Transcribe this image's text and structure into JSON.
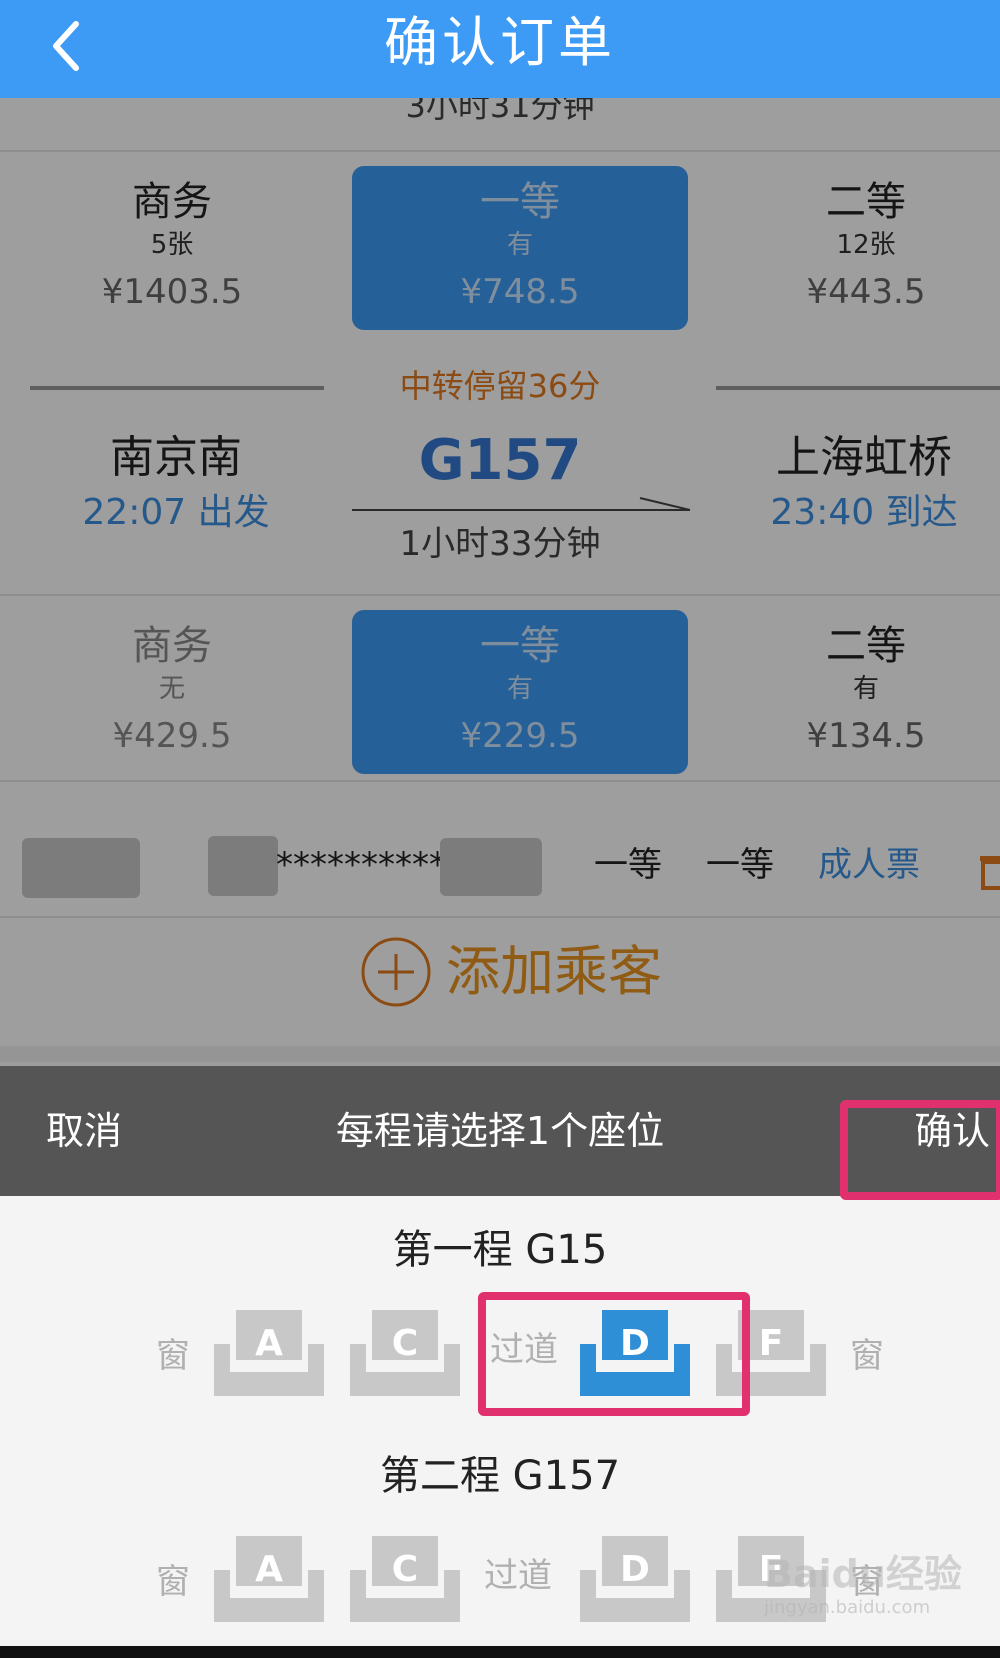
{
  "header": {
    "title": "确认订单"
  },
  "previous_leg": {
    "duration": "3小时31分钟"
  },
  "leg1_seats": [
    {
      "class": "商务",
      "count": "5张",
      "price": "¥1403.5",
      "selected": false
    },
    {
      "class": "一等",
      "count": "有",
      "price": "¥748.5",
      "selected": true
    },
    {
      "class": "二等",
      "count": "12张",
      "price": "¥443.5",
      "selected": false
    }
  ],
  "transfer": {
    "text": "中转停留36分"
  },
  "leg2": {
    "from_station": "南京南",
    "depart_time": "22:07 出发",
    "train_no": "G157",
    "duration": "1小时33分钟",
    "to_station": "上海虹桥",
    "arrive_time": "23:40 到达"
  },
  "leg2_seats": [
    {
      "class": "商务",
      "count": "无",
      "price": "¥429.5",
      "selected": false
    },
    {
      "class": "一等",
      "count": "有",
      "price": "¥229.5",
      "selected": true
    },
    {
      "class": "二等",
      "count": "有",
      "price": "¥134.5",
      "selected": false
    }
  ],
  "passenger": {
    "id_masked": "***********1",
    "seat_leg1": "一等",
    "seat_leg2": "一等",
    "ticket_type": "成人票"
  },
  "add_passenger": {
    "label": "添加乘客"
  },
  "picker": {
    "cancel_label": "取消",
    "title": "每程请选择1个座位",
    "confirm_label": "确认"
  },
  "legs": [
    {
      "title": "第一程 G15",
      "window_label": "窗",
      "aisle_label": "过道",
      "seats": [
        {
          "letter": "A",
          "selected": false
        },
        {
          "letter": "C",
          "selected": false
        },
        {
          "letter": "D",
          "selected": true
        },
        {
          "letter": "F",
          "selected": false
        }
      ]
    },
    {
      "title": "第二程 G157",
      "window_label": "窗",
      "aisle_label": "过道",
      "seats": [
        {
          "letter": "A",
          "selected": false
        },
        {
          "letter": "C",
          "selected": false
        },
        {
          "letter": "D",
          "selected": false
        },
        {
          "letter": "F",
          "selected": false
        }
      ]
    }
  ],
  "watermark": {
    "main": "Baidu经验",
    "sub": "jingyan.baidu.com"
  },
  "colors": {
    "header": "#3d9bf5",
    "selected_seat": "#2e8fd6",
    "unselected_seat": "#c8c8c8",
    "highlight": "#e0306e",
    "transfer": "#e07a1f",
    "add_passenger": "#e8941f"
  }
}
